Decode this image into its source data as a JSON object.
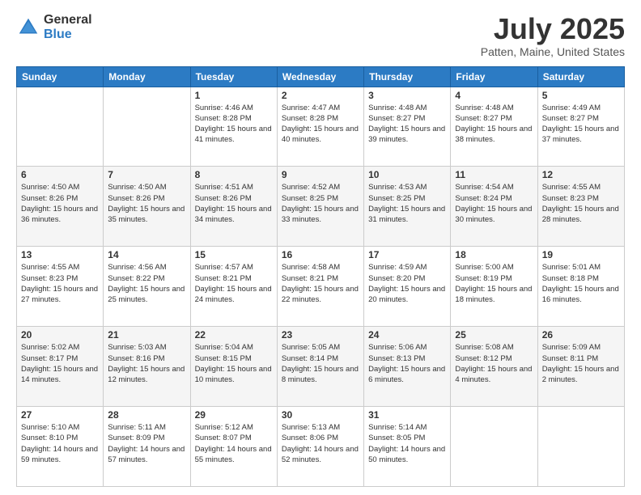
{
  "header": {
    "logo_general": "General",
    "logo_blue": "Blue",
    "title": "July 2025",
    "location": "Patten, Maine, United States"
  },
  "days_of_week": [
    "Sunday",
    "Monday",
    "Tuesday",
    "Wednesday",
    "Thursday",
    "Friday",
    "Saturday"
  ],
  "weeks": [
    [
      {
        "day": "",
        "info": ""
      },
      {
        "day": "",
        "info": ""
      },
      {
        "day": "1",
        "info": "Sunrise: 4:46 AM\nSunset: 8:28 PM\nDaylight: 15 hours and 41 minutes."
      },
      {
        "day": "2",
        "info": "Sunrise: 4:47 AM\nSunset: 8:28 PM\nDaylight: 15 hours and 40 minutes."
      },
      {
        "day": "3",
        "info": "Sunrise: 4:48 AM\nSunset: 8:27 PM\nDaylight: 15 hours and 39 minutes."
      },
      {
        "day": "4",
        "info": "Sunrise: 4:48 AM\nSunset: 8:27 PM\nDaylight: 15 hours and 38 minutes."
      },
      {
        "day": "5",
        "info": "Sunrise: 4:49 AM\nSunset: 8:27 PM\nDaylight: 15 hours and 37 minutes."
      }
    ],
    [
      {
        "day": "6",
        "info": "Sunrise: 4:50 AM\nSunset: 8:26 PM\nDaylight: 15 hours and 36 minutes."
      },
      {
        "day": "7",
        "info": "Sunrise: 4:50 AM\nSunset: 8:26 PM\nDaylight: 15 hours and 35 minutes."
      },
      {
        "day": "8",
        "info": "Sunrise: 4:51 AM\nSunset: 8:26 PM\nDaylight: 15 hours and 34 minutes."
      },
      {
        "day": "9",
        "info": "Sunrise: 4:52 AM\nSunset: 8:25 PM\nDaylight: 15 hours and 33 minutes."
      },
      {
        "day": "10",
        "info": "Sunrise: 4:53 AM\nSunset: 8:25 PM\nDaylight: 15 hours and 31 minutes."
      },
      {
        "day": "11",
        "info": "Sunrise: 4:54 AM\nSunset: 8:24 PM\nDaylight: 15 hours and 30 minutes."
      },
      {
        "day": "12",
        "info": "Sunrise: 4:55 AM\nSunset: 8:23 PM\nDaylight: 15 hours and 28 minutes."
      }
    ],
    [
      {
        "day": "13",
        "info": "Sunrise: 4:55 AM\nSunset: 8:23 PM\nDaylight: 15 hours and 27 minutes."
      },
      {
        "day": "14",
        "info": "Sunrise: 4:56 AM\nSunset: 8:22 PM\nDaylight: 15 hours and 25 minutes."
      },
      {
        "day": "15",
        "info": "Sunrise: 4:57 AM\nSunset: 8:21 PM\nDaylight: 15 hours and 24 minutes."
      },
      {
        "day": "16",
        "info": "Sunrise: 4:58 AM\nSunset: 8:21 PM\nDaylight: 15 hours and 22 minutes."
      },
      {
        "day": "17",
        "info": "Sunrise: 4:59 AM\nSunset: 8:20 PM\nDaylight: 15 hours and 20 minutes."
      },
      {
        "day": "18",
        "info": "Sunrise: 5:00 AM\nSunset: 8:19 PM\nDaylight: 15 hours and 18 minutes."
      },
      {
        "day": "19",
        "info": "Sunrise: 5:01 AM\nSunset: 8:18 PM\nDaylight: 15 hours and 16 minutes."
      }
    ],
    [
      {
        "day": "20",
        "info": "Sunrise: 5:02 AM\nSunset: 8:17 PM\nDaylight: 15 hours and 14 minutes."
      },
      {
        "day": "21",
        "info": "Sunrise: 5:03 AM\nSunset: 8:16 PM\nDaylight: 15 hours and 12 minutes."
      },
      {
        "day": "22",
        "info": "Sunrise: 5:04 AM\nSunset: 8:15 PM\nDaylight: 15 hours and 10 minutes."
      },
      {
        "day": "23",
        "info": "Sunrise: 5:05 AM\nSunset: 8:14 PM\nDaylight: 15 hours and 8 minutes."
      },
      {
        "day": "24",
        "info": "Sunrise: 5:06 AM\nSunset: 8:13 PM\nDaylight: 15 hours and 6 minutes."
      },
      {
        "day": "25",
        "info": "Sunrise: 5:08 AM\nSunset: 8:12 PM\nDaylight: 15 hours and 4 minutes."
      },
      {
        "day": "26",
        "info": "Sunrise: 5:09 AM\nSunset: 8:11 PM\nDaylight: 15 hours and 2 minutes."
      }
    ],
    [
      {
        "day": "27",
        "info": "Sunrise: 5:10 AM\nSunset: 8:10 PM\nDaylight: 14 hours and 59 minutes."
      },
      {
        "day": "28",
        "info": "Sunrise: 5:11 AM\nSunset: 8:09 PM\nDaylight: 14 hours and 57 minutes."
      },
      {
        "day": "29",
        "info": "Sunrise: 5:12 AM\nSunset: 8:07 PM\nDaylight: 14 hours and 55 minutes."
      },
      {
        "day": "30",
        "info": "Sunrise: 5:13 AM\nSunset: 8:06 PM\nDaylight: 14 hours and 52 minutes."
      },
      {
        "day": "31",
        "info": "Sunrise: 5:14 AM\nSunset: 8:05 PM\nDaylight: 14 hours and 50 minutes."
      },
      {
        "day": "",
        "info": ""
      },
      {
        "day": "",
        "info": ""
      }
    ]
  ]
}
